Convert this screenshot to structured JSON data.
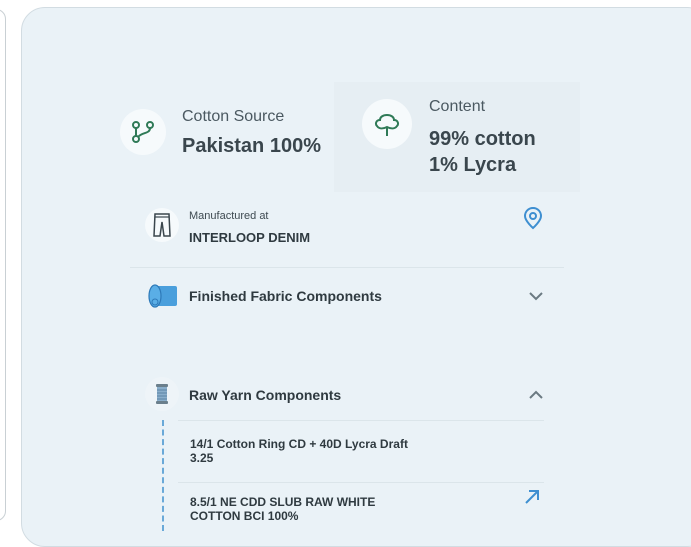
{
  "cotton_source": {
    "label": "Cotton Source",
    "value": "Pakistan 100%",
    "icon": "branch-icon"
  },
  "content": {
    "label": "Content",
    "line1": "99% cotton",
    "line2": "1% Lycra",
    "icon": "cotton-plant-icon"
  },
  "manufactured": {
    "label": "Manufactured at",
    "value": "INTERLOOP DENIM",
    "icon": "jeans-icon",
    "action_icon": "location-pin-icon"
  },
  "finished_fabric": {
    "title": "Finished Fabric Components",
    "icon": "fabric-roll-icon",
    "toggle_icon": "chevron-down-icon"
  },
  "raw_yarn": {
    "title": "Raw Yarn Components",
    "icon": "yarn-spool-icon",
    "toggle_icon": "chevron-up-icon",
    "items": [
      {
        "line1": "14/1 Cotton Ring CD + 40D Lycra Draft",
        "line2": "3.25"
      },
      {
        "line1": "8.5/1 NE CDD SLUB RAW WHITE",
        "line2": "COTTON BCI 100%",
        "action_icon": "arrow-up-right-icon"
      }
    ]
  },
  "colors": {
    "card_bg": "#eaf2f7",
    "accent_blue": "#3e8fd1",
    "icon_green": "#2f7a57"
  }
}
